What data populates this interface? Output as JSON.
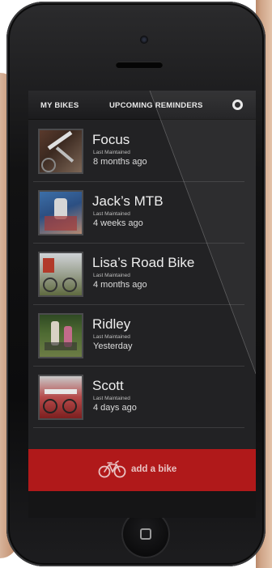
{
  "nav": {
    "tab_my_bikes": "MY BIKES",
    "tab_reminders": "UPCOMING REMINDERS",
    "settings_icon": "gear-icon"
  },
  "bikes": [
    {
      "name": "Focus",
      "label": "Last Maintained",
      "value": "8 months ago"
    },
    {
      "name": "Jack’s MTB",
      "label": "Last Maintained",
      "value": "4 weeks ago"
    },
    {
      "name": "Lisa’s Road Bike",
      "label": "Last Maintained",
      "value": "4 months ago"
    },
    {
      "name": "Ridley",
      "label": "Last Maintained",
      "value": "Yesterday"
    },
    {
      "name": "Scott",
      "label": "Last Maintained",
      "value": "4 days ago"
    }
  ],
  "add_bike": {
    "label": "add a bike",
    "icon": "bicycle-icon"
  },
  "colors": {
    "accent": "#b0191a",
    "background": "#222224",
    "text": "#eeeeee"
  }
}
